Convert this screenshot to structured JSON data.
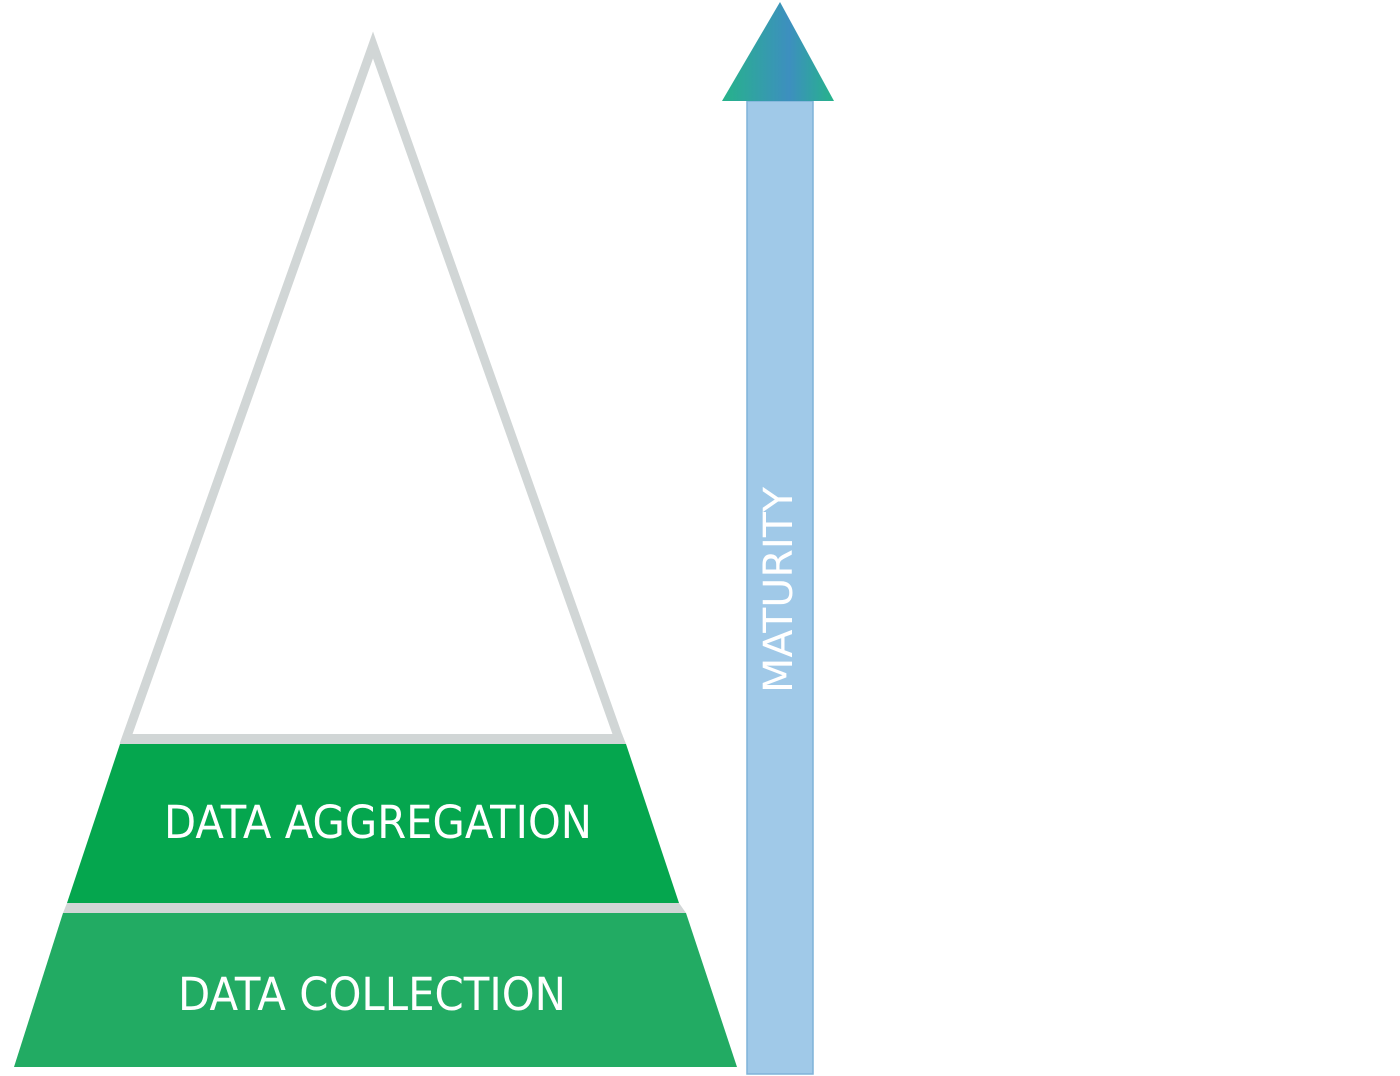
{
  "pyramid": {
    "outline_color": "#d1d6d6",
    "layers": [
      {
        "label": "DATA AGGREGATION",
        "color": "#05a64e"
      },
      {
        "label": "DATA COLLECTION",
        "color": "#22ab63"
      }
    ]
  },
  "maturity_arrow": {
    "label": "MATURITY",
    "shaft_color": "#a0c9e8",
    "head_colors": [
      "#26b38a",
      "#3d8fbf"
    ]
  }
}
